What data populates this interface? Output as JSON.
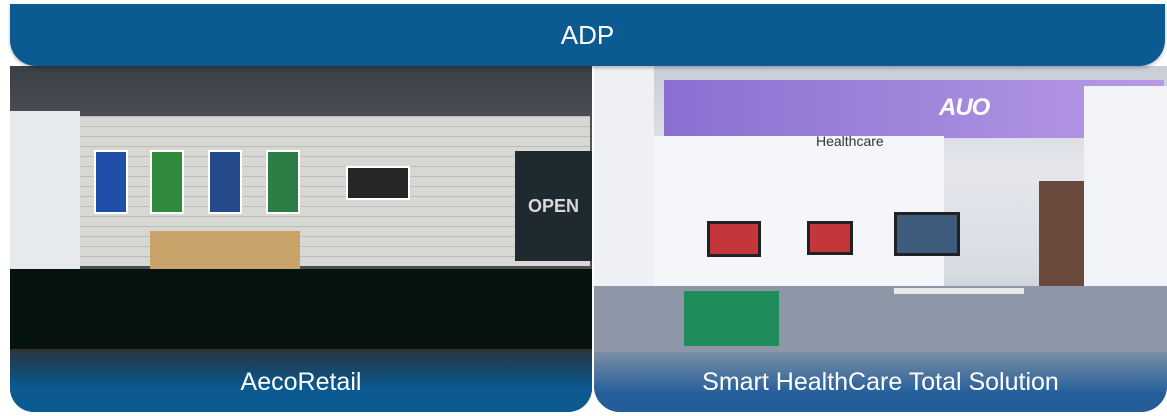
{
  "header": {
    "title": "ADP"
  },
  "panels": [
    {
      "caption": "AecoRetail",
      "sign": "OPEN"
    },
    {
      "caption": "Smart HealthCare Total Solution",
      "booth_label": "Healthcare",
      "brand": "AUO"
    }
  ],
  "colors": {
    "header_bg": "#0b5a92",
    "caption_text": "#ffffff"
  }
}
